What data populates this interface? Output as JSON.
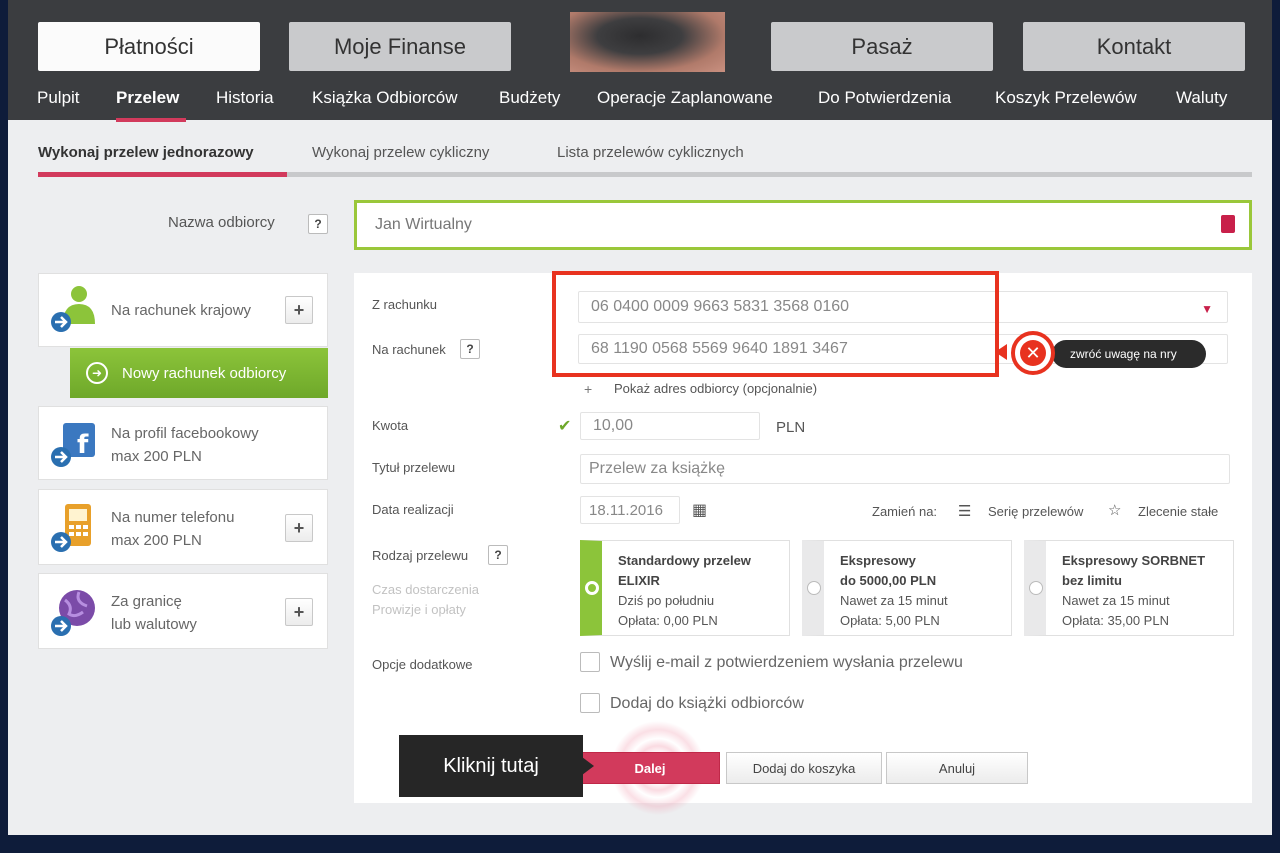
{
  "top_tabs": [
    "Płatności",
    "Moje Finanse",
    "Pasaż",
    "Kontakt"
  ],
  "subnav": [
    "Pulpit",
    "Przelew",
    "Historia",
    "Książka Odbiorców",
    "Budżety",
    "Operacje Zaplanowane",
    "Do Potwierdzenia",
    "Koszyk Przelewów",
    "Waluty"
  ],
  "tabs": [
    "Wykonaj przelew jednorazowy",
    "Wykonaj przelew cykliczny",
    "Lista przelewów cyklicznych"
  ],
  "recipient": {
    "label": "Nazwa odbiorcy",
    "help": "?",
    "value": "Jan Wirtualny"
  },
  "sidebar": {
    "domestic": "Na rachunek krajowy",
    "new_account": "Nowy rachunek odbiorcy",
    "facebook_line1": "Na profil facebookowy",
    "facebook_line2": "max 200 PLN",
    "phone_line1": "Na numer telefonu",
    "phone_line2": "max 200 PLN",
    "abroad_line1": "Za granicę",
    "abroad_line2": "lub walutowy",
    "plus": "+"
  },
  "form": {
    "from_label": "Z rachunku",
    "from_value": "06 0400 0009 9663 5831 3568 0160",
    "to_label": "Na rachunek",
    "to_value": "68 1190 0568 5569 9640 1891 3467",
    "show_address": "Pokaż adres odbiorcy (opcjonalnie)",
    "amount_label": "Kwota",
    "amount_value": "10,00",
    "currency": "PLN",
    "title_label": "Tytuł przelewu",
    "title_value": "Przelew za książkę",
    "date_label": "Data realizacji",
    "date_value": "18.11.2016",
    "swap_label": "Zamień na:",
    "series_label": "Serię przelewów",
    "standing_label": "Zlecenie stałe",
    "type_label": "Rodzaj przelewu",
    "delivery_label": "Czas dostarczenia",
    "fees_label": "Prowizje i opłaty",
    "extra_label": "Opcje dodatkowe",
    "email_option": "Wyślij e-mail z potwierdzeniem wysłania przelewu",
    "addbook_option": "Dodaj do książki odbiorców"
  },
  "transfer_types": [
    {
      "title1": "Standardowy przelew",
      "title2": "ELIXIR",
      "time": "Dziś po południu",
      "fee": "Opłata: 0,00 PLN"
    },
    {
      "title1": "Ekspresowy",
      "title2": "do 5000,00 PLN",
      "time": "Nawet za 15 minut",
      "fee": "Opłata: 5,00 PLN"
    },
    {
      "title1": "Ekspresowy SORBNET",
      "title2": "bez limitu",
      "time": "Nawet za 15 minut",
      "fee": "Opłata: 35,00 PLN"
    }
  ],
  "buttons": {
    "next": "Dalej",
    "add_to_cart": "Dodaj do koszyka",
    "cancel": "Anuluj"
  },
  "annotations": {
    "warning": "zwróć uwagę na nry",
    "click_here": "Kliknij tutaj"
  },
  "colors": {
    "accent": "#d23a5c",
    "green": "#8cc43a",
    "annotation_red": "#e8321f"
  }
}
